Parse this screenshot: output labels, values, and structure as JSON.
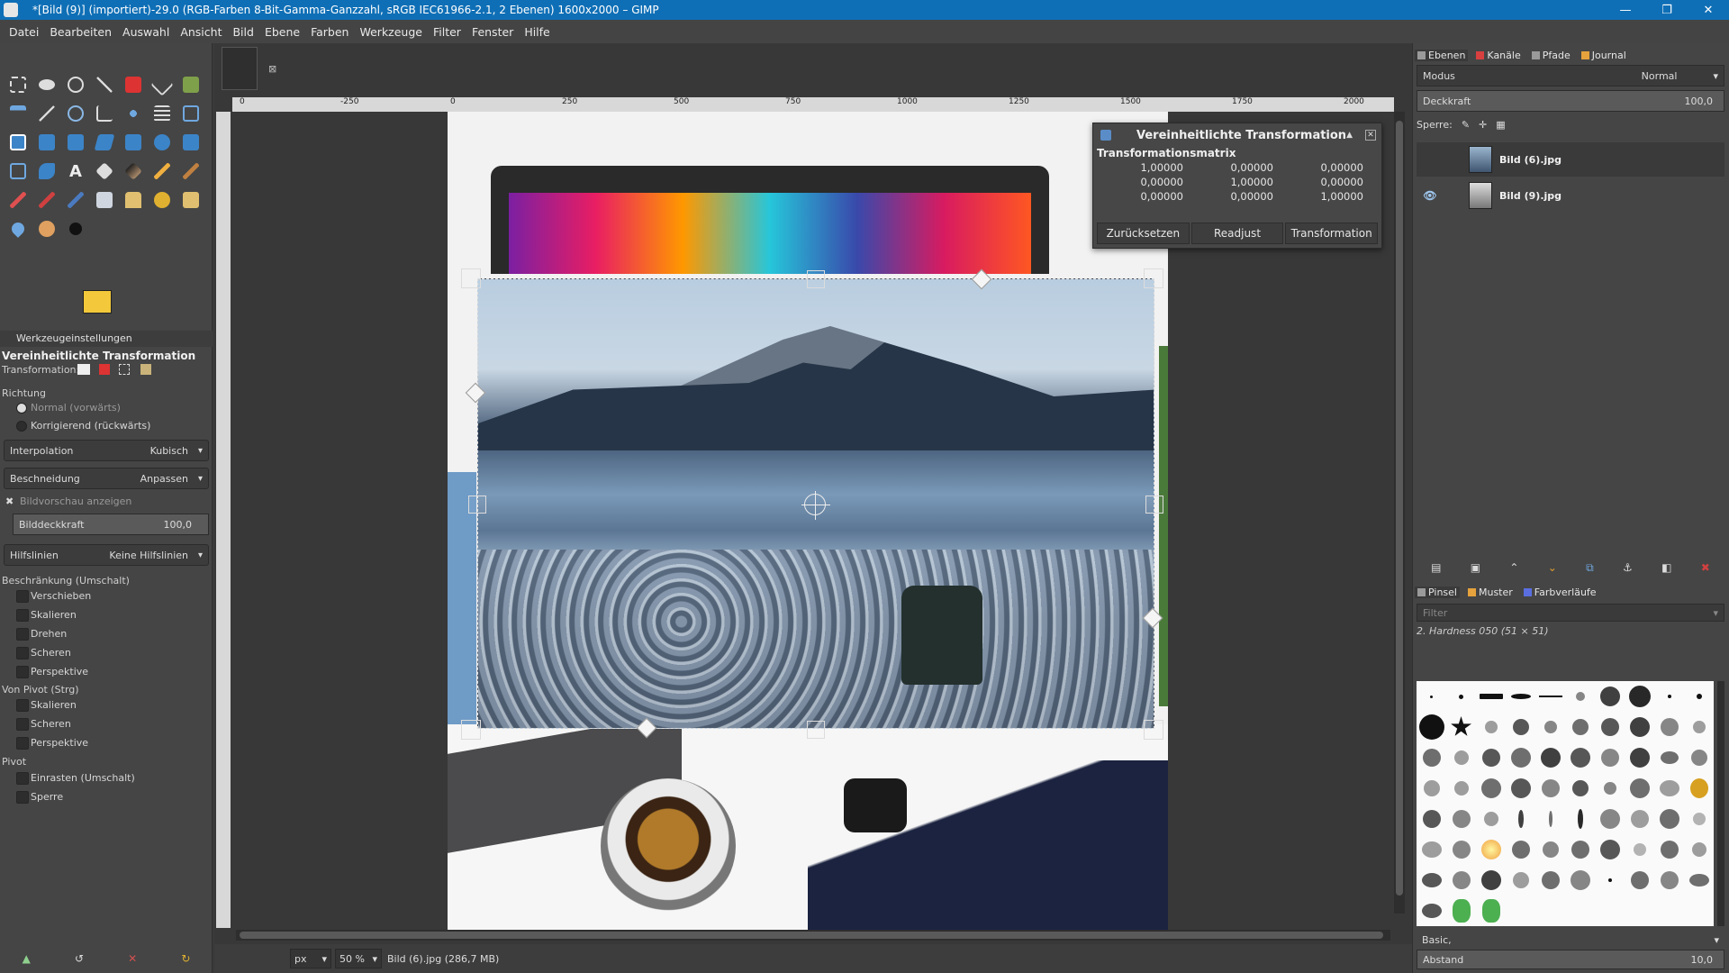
{
  "window": {
    "title": "*[Bild (9)] (importiert)-29.0 (RGB-Farben 8-Bit-Gamma-Ganzzahl, sRGB IEC61966-2.1, 2 Ebenen) 1600x2000 – GIMP",
    "minimize": "—",
    "restore": "❐",
    "close": "✕"
  },
  "menu": [
    "Datei",
    "Bearbeiten",
    "Auswahl",
    "Ansicht",
    "Bild",
    "Ebene",
    "Farben",
    "Werkzeuge",
    "Filter",
    "Fenster",
    "Hilfe"
  ],
  "tool_options": {
    "tab_label": "Werkzeugeinstellungen",
    "tool_title": "Vereinheitlichte Transformation",
    "transformation_label": "Transformation:",
    "direction_label": "Richtung",
    "direction_normal": "Normal (vorwärts)",
    "direction_corrective": "Korrigierend (rückwärts)",
    "interpolation_label": "Interpolation",
    "interpolation_value": "Kubisch",
    "clipping_label": "Beschneidung",
    "clipping_value": "Anpassen",
    "show_preview": "Bildvorschau anzeigen",
    "opacity_label": "Bilddeckkraft",
    "opacity_value": "100,0",
    "guides_label": "Hilfslinien",
    "guides_value": "Keine Hilfslinien",
    "constraints_label": "Beschränkung (Umschalt)",
    "constraints": [
      "Verschieben",
      "Skalieren",
      "Drehen",
      "Scheren",
      "Perspektive"
    ],
    "from_pivot_label": "Von Pivot (Strg)",
    "from_pivot": [
      "Skalieren",
      "Scheren",
      "Perspektive"
    ],
    "pivot_label": "Pivot",
    "pivot_options": [
      "Einrasten (Umschalt)",
      "Sperre"
    ]
  },
  "ruler": {
    "ticks": [
      "0",
      "-250",
      "0",
      "250",
      "500",
      "750",
      "1000",
      "1250",
      "1500",
      "1750",
      "2000"
    ]
  },
  "transform_dialog": {
    "title": "Vereinheitlichte Transformation",
    "matrix_title": "Transformationsmatrix",
    "matrix": [
      "1,00000",
      "0,00000",
      "0,00000",
      "0,00000",
      "1,00000",
      "0,00000",
      "0,00000",
      "0,00000",
      "1,00000"
    ],
    "buttons": [
      "Zurücksetzen",
      "Readjust",
      "Transformation"
    ]
  },
  "layers_dock": {
    "tabs": [
      {
        "label": "Ebenen",
        "color": "#9a9a9a"
      },
      {
        "label": "Kanäle",
        "color": "#d84040"
      },
      {
        "label": "Pfade",
        "color": "#9a9a9a"
      },
      {
        "label": "Journal",
        "color": "#e6a23c"
      }
    ],
    "mode_label": "Modus",
    "mode_value": "Normal",
    "opacity_label": "Deckkraft",
    "opacity_value": "100,0",
    "lock_label": "Sperre:",
    "layers": [
      {
        "name": "Bild (6).jpg",
        "visible": false
      },
      {
        "name": "Bild (9).jpg",
        "visible": true
      }
    ]
  },
  "brushes_dock": {
    "tabs": [
      {
        "label": "Pinsel",
        "color": "#9a9a9a"
      },
      {
        "label": "Muster",
        "color": "#e6a23c"
      },
      {
        "label": "Farbverläufe",
        "color": "#5a6ee0"
      }
    ],
    "filter_placeholder": "Filter",
    "brush_name": "2. Hardness 050 (51 × 51)",
    "preset": "Basic,",
    "spacing_label": "Abstand",
    "spacing_value": "10,0"
  },
  "statusbar": {
    "unit": "px",
    "zoom": "50 %",
    "info": "Bild (6).jpg (286,7 MB)"
  },
  "colors": {
    "fg": "#f3c93b",
    "bg": "#ffffff"
  }
}
